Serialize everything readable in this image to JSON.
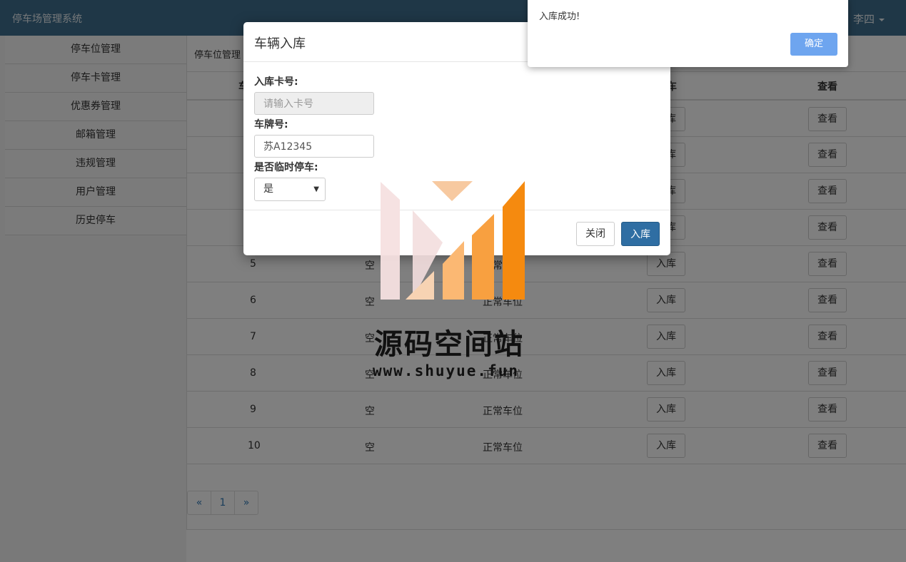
{
  "app": {
    "title": "停车场管理系统",
    "user": "李四"
  },
  "sidebar": {
    "items": [
      {
        "label": "停车位管理"
      },
      {
        "label": "停车卡管理"
      },
      {
        "label": "优惠券管理"
      },
      {
        "label": "邮箱管理"
      },
      {
        "label": "违规管理"
      },
      {
        "label": "用户管理"
      },
      {
        "label": "历史停车"
      }
    ]
  },
  "content": {
    "breadcrumb": "停车位管理",
    "headers": {
      "col1_partial": "车",
      "col4_partial": "车",
      "col5": "查看"
    },
    "rows": [
      {
        "id": "5",
        "status": "空",
        "type": "正常车位"
      },
      {
        "id": "6",
        "status": "空",
        "type": "正常车位"
      },
      {
        "id": "7",
        "status": "空",
        "type": "正常车位"
      },
      {
        "id": "8",
        "status": "空",
        "type": "正常车位"
      },
      {
        "id": "9",
        "status": "空",
        "type": "正常车位"
      },
      {
        "id": "10",
        "status": "空",
        "type": "正常车位"
      }
    ],
    "row_buttons": {
      "checkin": "入库",
      "view": "查看"
    },
    "pagination": {
      "prev": "«",
      "current": "1",
      "next": "»"
    }
  },
  "modal": {
    "title": "车辆入库",
    "card_label": "入库卡号:",
    "card_placeholder": "请输入卡号",
    "plate_label": "车牌号:",
    "plate_value": "苏A12345",
    "temp_label": "是否临时停车:",
    "temp_value": "是",
    "close_label": "关闭",
    "submit_label": "入库"
  },
  "alert": {
    "message": "入库成功!",
    "ok_label": "确定"
  },
  "watermark": {
    "title": "源码空间站",
    "url": "www.shuyue.fun"
  }
}
